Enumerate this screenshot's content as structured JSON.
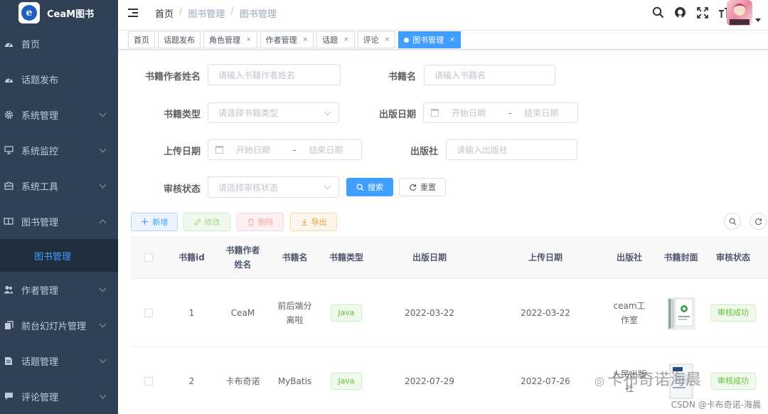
{
  "app": {
    "title": "CeaM图书",
    "logo_letter": "e"
  },
  "sidebar": {
    "items": [
      {
        "label": "首页",
        "icon": "dashboard-icon",
        "expandable": false
      },
      {
        "label": "话题发布",
        "icon": "dashboard-icon",
        "expandable": false
      },
      {
        "label": "系统管理",
        "icon": "gear-icon",
        "expandable": true
      },
      {
        "label": "系统监控",
        "icon": "monitor-icon",
        "expandable": true
      },
      {
        "label": "系统工具",
        "icon": "toolbox-icon",
        "expandable": true
      },
      {
        "label": "图书管理",
        "icon": "book-icon",
        "expandable": true,
        "open": true
      },
      {
        "label": "作者管理",
        "icon": "users-icon",
        "expandable": true
      },
      {
        "label": "前台幻灯片管理",
        "icon": "slides-icon",
        "expandable": true
      },
      {
        "label": "话题管理",
        "icon": "document-icon",
        "expandable": true
      },
      {
        "label": "评论管理",
        "icon": "comment-icon",
        "expandable": true
      }
    ],
    "submenu_label": "图书管理"
  },
  "header": {
    "breadcrumb": [
      "首页",
      "图书管理",
      "图书管理"
    ],
    "icons": [
      "search-icon",
      "github-icon",
      "fullscreen-icon",
      "font-size-icon"
    ]
  },
  "tags": [
    {
      "label": "首页",
      "closable": false,
      "active": false
    },
    {
      "label": "话题发布",
      "closable": false,
      "active": false
    },
    {
      "label": "角色管理",
      "closable": true,
      "active": false
    },
    {
      "label": "作者管理",
      "closable": true,
      "active": false
    },
    {
      "label": "话题",
      "closable": true,
      "active": false
    },
    {
      "label": "评论",
      "closable": true,
      "active": false
    },
    {
      "label": "图书管理",
      "closable": true,
      "active": true
    }
  ],
  "form": {
    "author_name": {
      "label": "书籍作者姓名",
      "placeholder": "请输入书籍作者姓名"
    },
    "book_name": {
      "label": "书籍名",
      "placeholder": "请输入书籍名"
    },
    "book_type": {
      "label": "书籍类型",
      "placeholder": "请选择书籍类型"
    },
    "publish_date": {
      "label": "出版日期",
      "start": "开始日期",
      "sep": "-",
      "end": "结束日期"
    },
    "upload_date": {
      "label": "上传日期",
      "start": "开始日期",
      "sep": "-",
      "end": "结束日期"
    },
    "publisher": {
      "label": "出版社",
      "placeholder": "请输入出版社"
    },
    "status": {
      "label": "审核状态",
      "placeholder": "请选择审核状态"
    },
    "search_label": "搜索",
    "reset_label": "重置"
  },
  "toolbar": {
    "add": "新增",
    "edit": "修改",
    "delete": "删除",
    "export": "导出"
  },
  "table": {
    "columns": [
      "书籍id",
      "书籍作者\n姓名",
      "书籍名",
      "书籍类型",
      "出版日期",
      "上传日期",
      "出版社",
      "书籍封面",
      "审核状态"
    ],
    "rows": [
      {
        "id": "1",
        "author": "CeaM",
        "name": "前后端分\n离啦",
        "type": "Java",
        "publish_date": "2022-03-22",
        "upload_date": "2022-03-22",
        "publisher": "ceam工\n作室",
        "status": "审核成功"
      },
      {
        "id": "2",
        "author": "卡布奇诺",
        "name": "MyBatis",
        "type": "Java",
        "publish_date": "2022-07-29",
        "upload_date": "2022-07-26",
        "publisher": "人民出版\n社",
        "status": "审核成功"
      }
    ]
  },
  "watermark": "卡布奇诺海晨",
  "footer_credit": "CSDN @卡布奇诺-海晨",
  "colors": {
    "sidebar_bg": "#304156",
    "submenu_bg": "#1f2d3d",
    "primary": "#409eff",
    "success": "#67c23a"
  }
}
